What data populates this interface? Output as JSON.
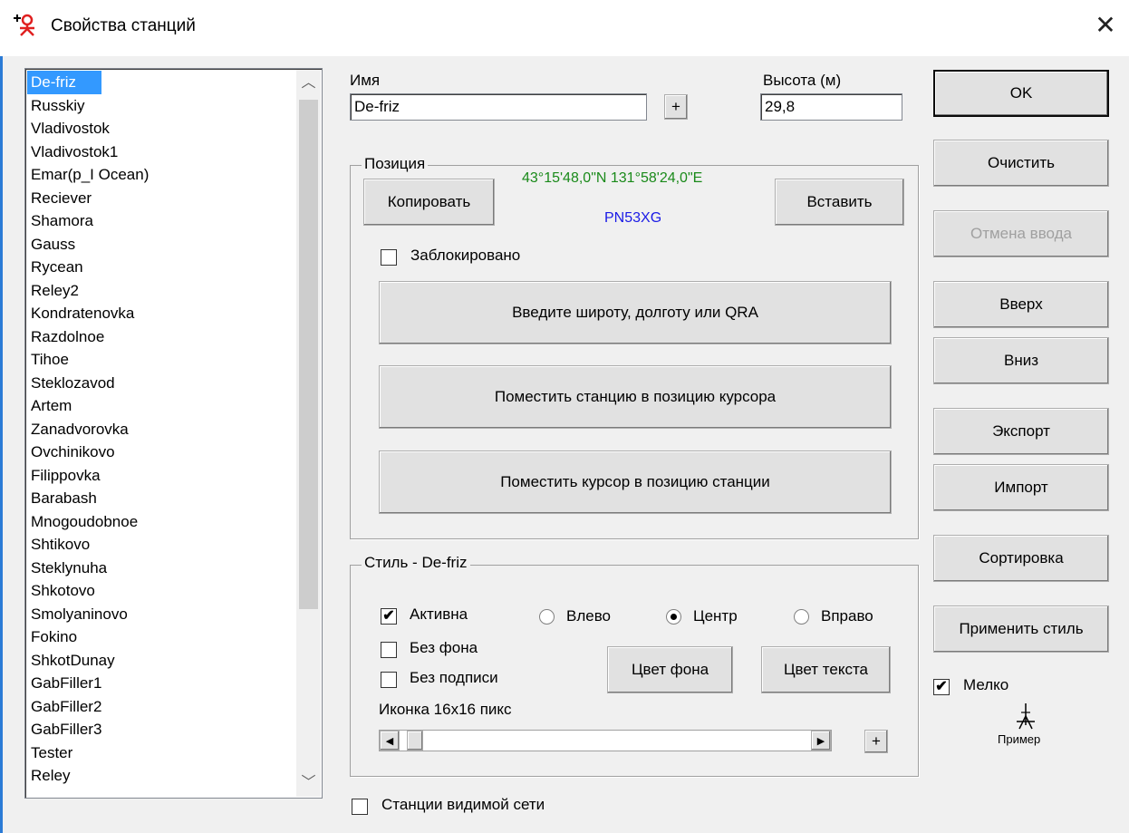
{
  "window": {
    "title": "Свойства станций",
    "close_glyph": "✕"
  },
  "stations": {
    "selected": "De-friz",
    "items": [
      "De-friz",
      "Russkiy",
      "Vladivostok",
      "Vladivostok1",
      "Emar(p_I Ocean)",
      "Reciever",
      "Shamora",
      "Gauss",
      "Rycean",
      "Reley2",
      "Kondratenovka",
      "Razdolnoe",
      "Tihoe",
      "Steklozavod",
      "Artem",
      "Zanadvorovka",
      "Ovchinikovo",
      "Filippovka",
      "Barabash",
      "Mnogoudobnoe",
      "Shtikovo",
      "Steklynuha",
      "Shkotovo",
      "Smolyaninovo",
      "Fokino",
      "ShkotDunay",
      "GabFiller1",
      "GabFiller2",
      "GabFiller3",
      "Tester",
      "Reley"
    ],
    "scroll_up_glyph": "︿",
    "scroll_down_glyph": "﹀"
  },
  "name": {
    "label": "Имя",
    "value": "De-friz",
    "plus_label": "+"
  },
  "height": {
    "label": "Высота (м)",
    "value": "29,8"
  },
  "position": {
    "group_title": "Позиция",
    "coords": "43°15'48,0\"N 131°58'24,0\"E",
    "qra": "PN53XG",
    "coords_color": "#1a8a1a",
    "qra_color": "#1a1ae6",
    "copy_label": "Копировать",
    "paste_label": "Вставить",
    "locked_label": "Заблокировано",
    "locked_checked": false,
    "enter_label": "Введите широту, долготу или QRA",
    "station_to_cursor_label": "Поместить станцию в позицию курсора",
    "cursor_to_station_label": "Поместить курсор в позицию станции"
  },
  "style": {
    "group_title": "Стиль - De-friz",
    "active_label": "Активна",
    "active_checked": true,
    "align_left_label": "Влево",
    "align_center_label": "Центр",
    "align_right_label": "Вправо",
    "align_selected": "center",
    "no_bg_label": "Без фона",
    "no_bg_checked": false,
    "no_caption_label": "Без подписи",
    "no_caption_checked": false,
    "bg_color_label": "Цвет фона",
    "text_color_label": "Цвет текста",
    "icon_label": "Иконка 16x16 пикс",
    "icon_slider_fraction": 0.0,
    "plus_label": "+",
    "left_arrow": "◀",
    "right_arrow": "▶"
  },
  "visible_network": {
    "label": "Станции видимой сети",
    "checked": false
  },
  "actions": {
    "ok": "OK",
    "clear": "Очистить",
    "undo": "Отмена ввода",
    "up": "Вверх",
    "down": "Вниз",
    "export": "Экспорт",
    "import": "Импорт",
    "sort": "Сортировка",
    "apply_style": "Применить стиль"
  },
  "small": {
    "label": "Мелко",
    "checked": true
  },
  "preview": {
    "label": "Пример"
  },
  "check_glyph": "✔"
}
